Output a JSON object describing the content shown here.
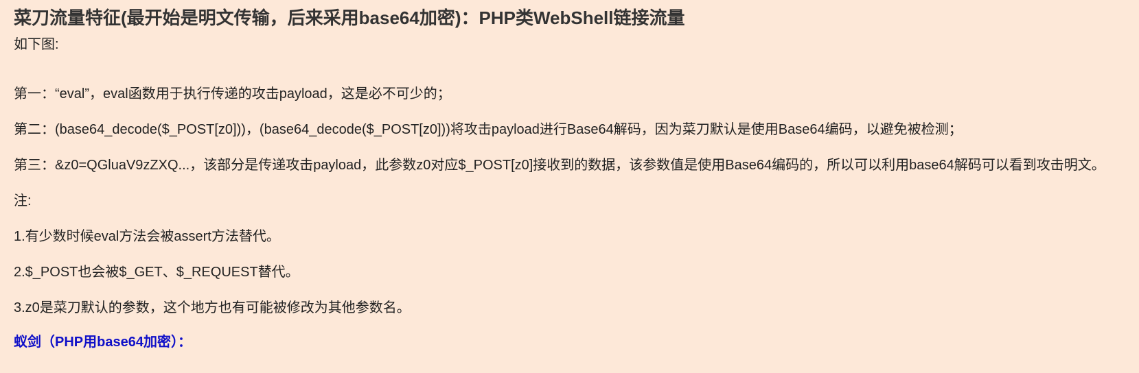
{
  "article": {
    "title": "菜刀流量特征(最开始是明文传输，后来采用base64加密)：PHP类WebShell链接流量",
    "intro": "如下图:",
    "point1": "第一：“eval”，eval函数用于执行传递的攻击payload，这是必不可少的；",
    "point2": "第二：(base64_decode($_POST[z0]))，(base64_decode($_POST[z0]))将攻击payload进行Base64解码，因为菜刀默认是使用Base64编码，以避免被检测；",
    "point3": "第三：&z0=QGluaV9zZXQ...，该部分是传递攻击payload，此参数z0对应$_POST[z0]接收到的数据，该参数值是使用Base64编码的，所以可以利用base64解码可以看到攻击明文。",
    "note_label": "注:",
    "note1": "1.有少数时候eval方法会被assert方法替代。",
    "note2": "2.$_POST也会被$_GET、$_REQUEST替代。",
    "note3": "3.z0是菜刀默认的参数，这个地方也有可能被修改为其他参数名。",
    "next_heading": "蚁剑（PHP用base64加密）："
  }
}
